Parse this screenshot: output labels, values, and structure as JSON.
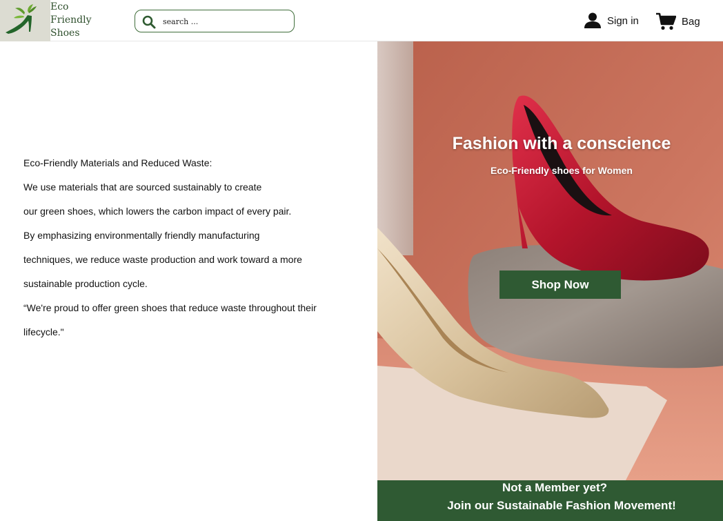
{
  "header": {
    "logo": {
      "line1": "Eco",
      "line2": "Friendly",
      "line3": "Shoes"
    },
    "search": {
      "placeholder": "search ...",
      "icon": "search-icon"
    },
    "signin": {
      "label": "Sign in",
      "icon": "user-icon"
    },
    "bag": {
      "label": "Bag",
      "icon": "cart-icon"
    }
  },
  "intro": {
    "lines": [
      "Eco-Friendly Materials and Reduced Waste:",
      "We use materials that are sourced sustainably to create",
      "our green shoes, which lowers the carbon impact of every pair.",
      "By emphasizing environmentally friendly manufacturing",
      "techniques, we reduce waste production and work toward a more",
      "sustainable production cycle.",
      "“We're proud to offer green shoes that reduce waste throughout their",
      "lifecycle.\""
    ]
  },
  "hero": {
    "title": "Fashion with a conscience",
    "subtitle": "Eco-Friendly shoes for Women",
    "cta": "Shop Now"
  },
  "member": {
    "line1": "Not a Member yet?",
    "line2": "Join our Sustainable Fashion Movement!"
  },
  "colors": {
    "brand_green": "#2f5a33",
    "hero_bg": "#c66f59"
  }
}
